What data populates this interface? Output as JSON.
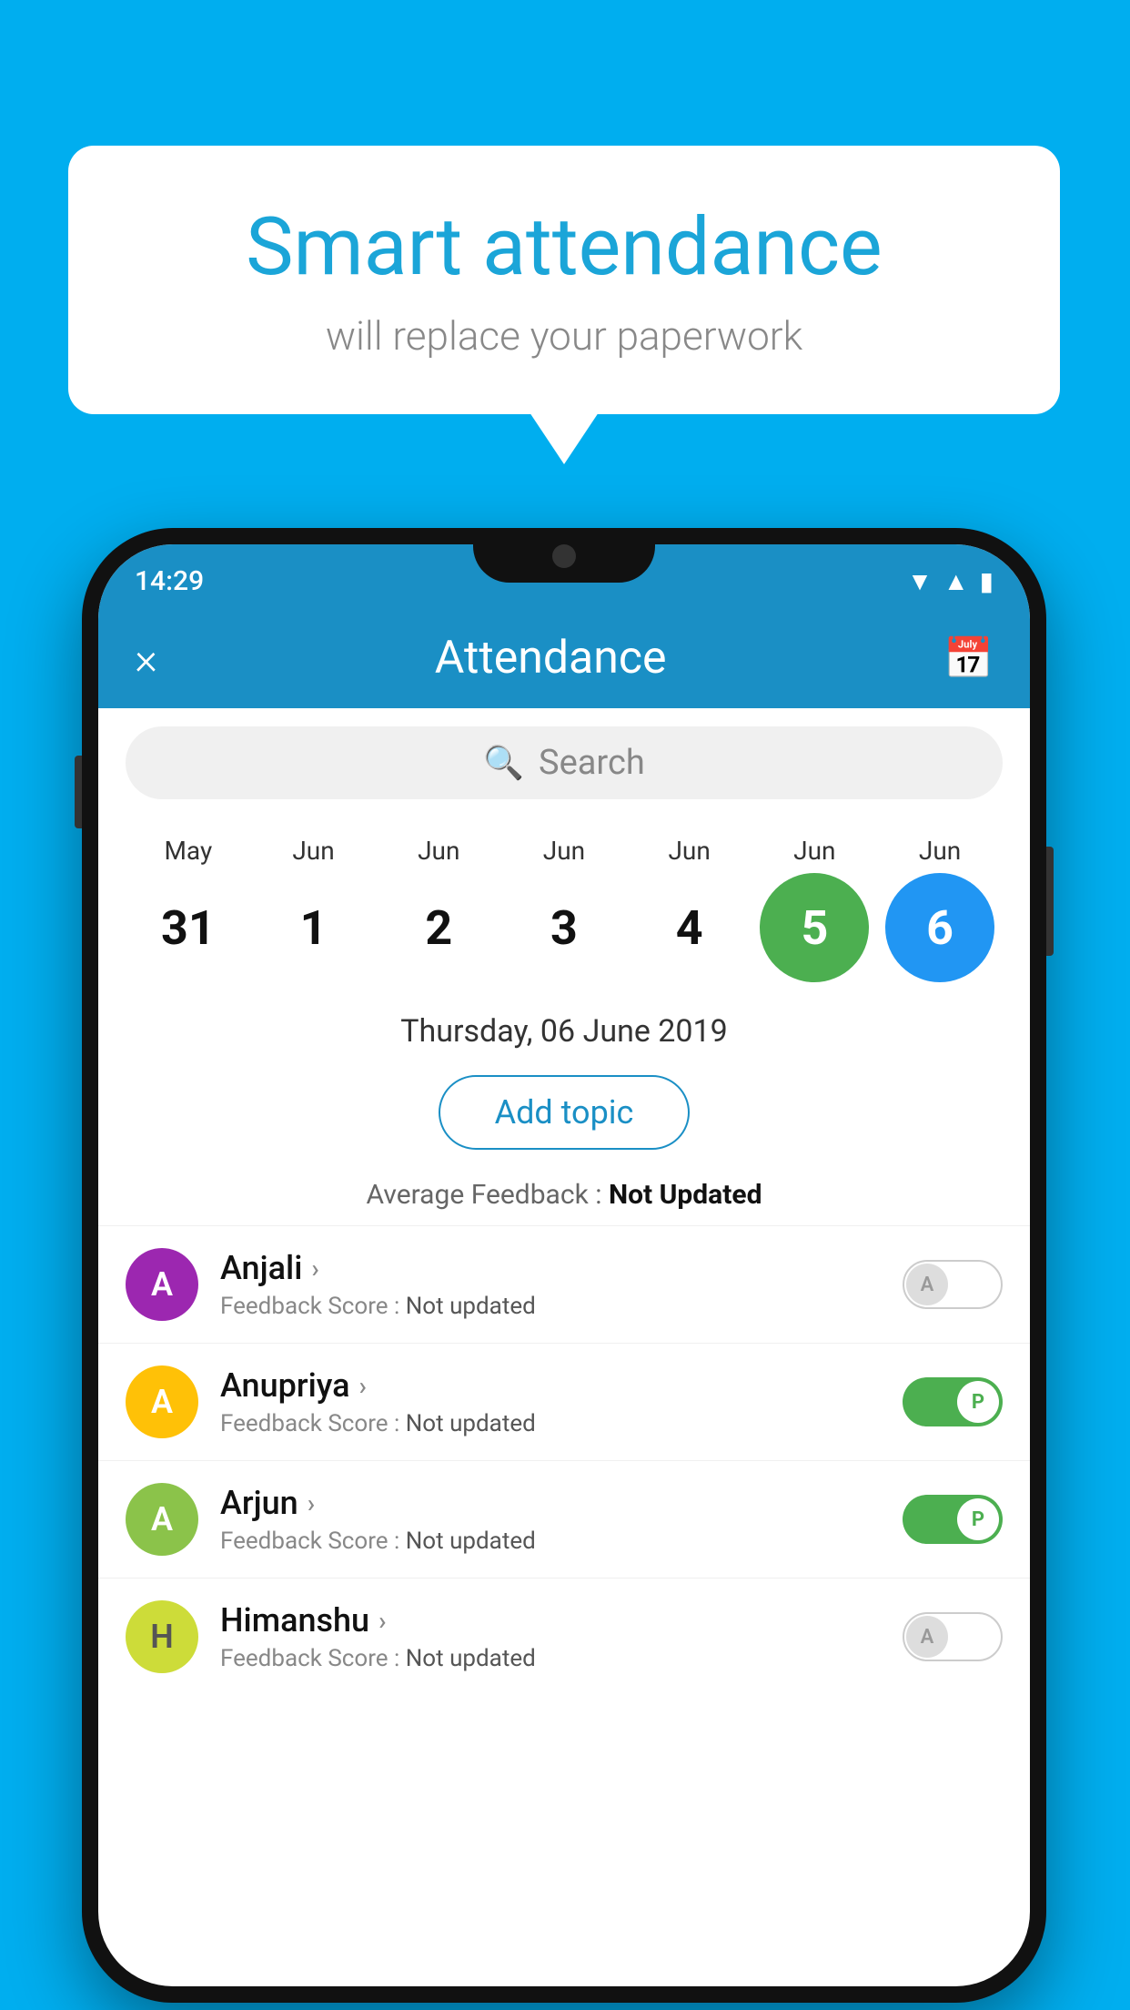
{
  "background_color": "#00AEEF",
  "bubble": {
    "title": "Smart attendance",
    "subtitle": "will replace your paperwork"
  },
  "phone": {
    "status_bar": {
      "time": "14:29",
      "icons": [
        "wifi",
        "signal",
        "battery"
      ]
    },
    "header": {
      "close_label": "×",
      "title": "Attendance",
      "calendar_icon": "calendar"
    },
    "search": {
      "placeholder": "Search"
    },
    "calendar": {
      "months": [
        "May",
        "Jun",
        "Jun",
        "Jun",
        "Jun",
        "Jun",
        "Jun"
      ],
      "dates": [
        "31",
        "1",
        "2",
        "3",
        "4",
        "5",
        "6"
      ],
      "selected_date_index": 5,
      "today_index": 6
    },
    "selected_date": "Thursday, 06 June 2019",
    "add_topic_label": "Add topic",
    "average_feedback": {
      "label": "Average Feedback : ",
      "value": "Not Updated"
    },
    "students": [
      {
        "name": "Anjali",
        "avatar_letter": "A",
        "avatar_color": "purple",
        "feedback_label": "Feedback Score : ",
        "feedback_value": "Not updated",
        "toggle_state": "off",
        "toggle_letter": "A"
      },
      {
        "name": "Anupriya",
        "avatar_letter": "A",
        "avatar_color": "yellow",
        "feedback_label": "Feedback Score : ",
        "feedback_value": "Not updated",
        "toggle_state": "on",
        "toggle_letter": "P"
      },
      {
        "name": "Arjun",
        "avatar_letter": "A",
        "avatar_color": "green",
        "feedback_label": "Feedback Score : ",
        "feedback_value": "Not updated",
        "toggle_state": "on",
        "toggle_letter": "P"
      },
      {
        "name": "Himanshu",
        "avatar_letter": "H",
        "avatar_color": "lime",
        "feedback_label": "Feedback Score : ",
        "feedback_value": "Not updated",
        "toggle_state": "off",
        "toggle_letter": "A"
      }
    ]
  }
}
